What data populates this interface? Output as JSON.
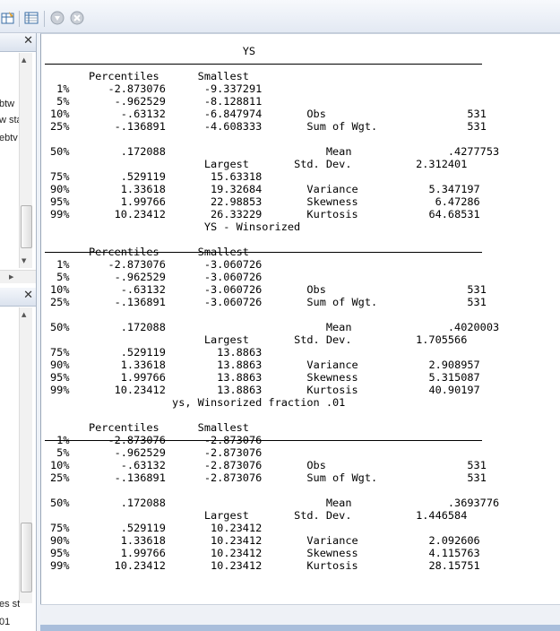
{
  "left_pane": {
    "upper_lines": [
      "btw",
      "w sta",
      "ebtv"
    ],
    "lower_lines": [
      "es st",
      "01"
    ]
  },
  "tables": [
    {
      "title": "YS",
      "header_percentiles": "Percentiles",
      "header_smallest": "Smallest",
      "header_largest": "Largest",
      "rows_low": [
        {
          "pct": "1%",
          "val": "-2.873076",
          "ext": "-9.337291",
          "stat": "",
          "stat_val": ""
        },
        {
          "pct": "5%",
          "val": "-.962529",
          "ext": "-8.128811",
          "stat": "",
          "stat_val": ""
        },
        {
          "pct": "10%",
          "val": "-.63132",
          "ext": "-6.847974",
          "stat": "Obs",
          "stat_val": "531"
        },
        {
          "pct": "25%",
          "val": "-.136891",
          "ext": "-4.608333",
          "stat": "Sum of Wgt.",
          "stat_val": "531"
        }
      ],
      "row_mid": {
        "pct": "50%",
        "val": ".172088",
        "stat": "Mean",
        "stat_val": ".4277753",
        "stat2": "Std. Dev.",
        "stat2_val": "2.312401"
      },
      "rows_high": [
        {
          "pct": "75%",
          "val": ".529119",
          "ext": "15.63318",
          "stat": "",
          "stat_val": ""
        },
        {
          "pct": "90%",
          "val": "1.33618",
          "ext": "19.32684",
          "stat": "Variance",
          "stat_val": "5.347197"
        },
        {
          "pct": "95%",
          "val": "1.99766",
          "ext": "22.98853",
          "stat": "Skewness",
          "stat_val": "6.47286"
        },
        {
          "pct": "99%",
          "val": "10.23412",
          "ext": "26.33229",
          "stat": "Kurtosis",
          "stat_val": "64.68531"
        }
      ]
    },
    {
      "title": "YS - Winsorized",
      "header_percentiles": "Percentiles",
      "header_smallest": "Smallest",
      "header_largest": "Largest",
      "rows_low": [
        {
          "pct": "1%",
          "val": "-2.873076",
          "ext": "-3.060726",
          "stat": "",
          "stat_val": ""
        },
        {
          "pct": "5%",
          "val": "-.962529",
          "ext": "-3.060726",
          "stat": "",
          "stat_val": ""
        },
        {
          "pct": "10%",
          "val": "-.63132",
          "ext": "-3.060726",
          "stat": "Obs",
          "stat_val": "531"
        },
        {
          "pct": "25%",
          "val": "-.136891",
          "ext": "-3.060726",
          "stat": "Sum of Wgt.",
          "stat_val": "531"
        }
      ],
      "row_mid": {
        "pct": "50%",
        "val": ".172088",
        "stat": "Mean",
        "stat_val": ".4020003",
        "stat2": "Std. Dev.",
        "stat2_val": "1.705566"
      },
      "rows_high": [
        {
          "pct": "75%",
          "val": ".529119",
          "ext": "13.8863",
          "stat": "",
          "stat_val": ""
        },
        {
          "pct": "90%",
          "val": "1.33618",
          "ext": "13.8863",
          "stat": "Variance",
          "stat_val": "2.908957"
        },
        {
          "pct": "95%",
          "val": "1.99766",
          "ext": "13.8863",
          "stat": "Skewness",
          "stat_val": "5.315087"
        },
        {
          "pct": "99%",
          "val": "10.23412",
          "ext": "13.8863",
          "stat": "Kurtosis",
          "stat_val": "40.90197"
        }
      ]
    },
    {
      "title": "ys, Winsorized fraction .01",
      "header_percentiles": "Percentiles",
      "header_smallest": "Smallest",
      "header_largest": "Largest",
      "rows_low": [
        {
          "pct": "1%",
          "val": "-2.873076",
          "ext": "-2.873076",
          "stat": "",
          "stat_val": ""
        },
        {
          "pct": "5%",
          "val": "-.962529",
          "ext": "-2.873076",
          "stat": "",
          "stat_val": ""
        },
        {
          "pct": "10%",
          "val": "-.63132",
          "ext": "-2.873076",
          "stat": "Obs",
          "stat_val": "531"
        },
        {
          "pct": "25%",
          "val": "-.136891",
          "ext": "-2.873076",
          "stat": "Sum of Wgt.",
          "stat_val": "531"
        }
      ],
      "row_mid": {
        "pct": "50%",
        "val": ".172088",
        "stat": "Mean",
        "stat_val": ".3693776",
        "stat2": "Std. Dev.",
        "stat2_val": "1.446584"
      },
      "rows_high": [
        {
          "pct": "75%",
          "val": ".529119",
          "ext": "10.23412",
          "stat": "",
          "stat_val": ""
        },
        {
          "pct": "90%",
          "val": "1.33618",
          "ext": "10.23412",
          "stat": "Variance",
          "stat_val": "2.092606"
        },
        {
          "pct": "95%",
          "val": "1.99766",
          "ext": "10.23412",
          "stat": "Skewness",
          "stat_val": "4.115763"
        },
        {
          "pct": "99%",
          "val": "10.23412",
          "ext": "10.23412",
          "stat": "Kurtosis",
          "stat_val": "28.15751"
        }
      ]
    }
  ]
}
